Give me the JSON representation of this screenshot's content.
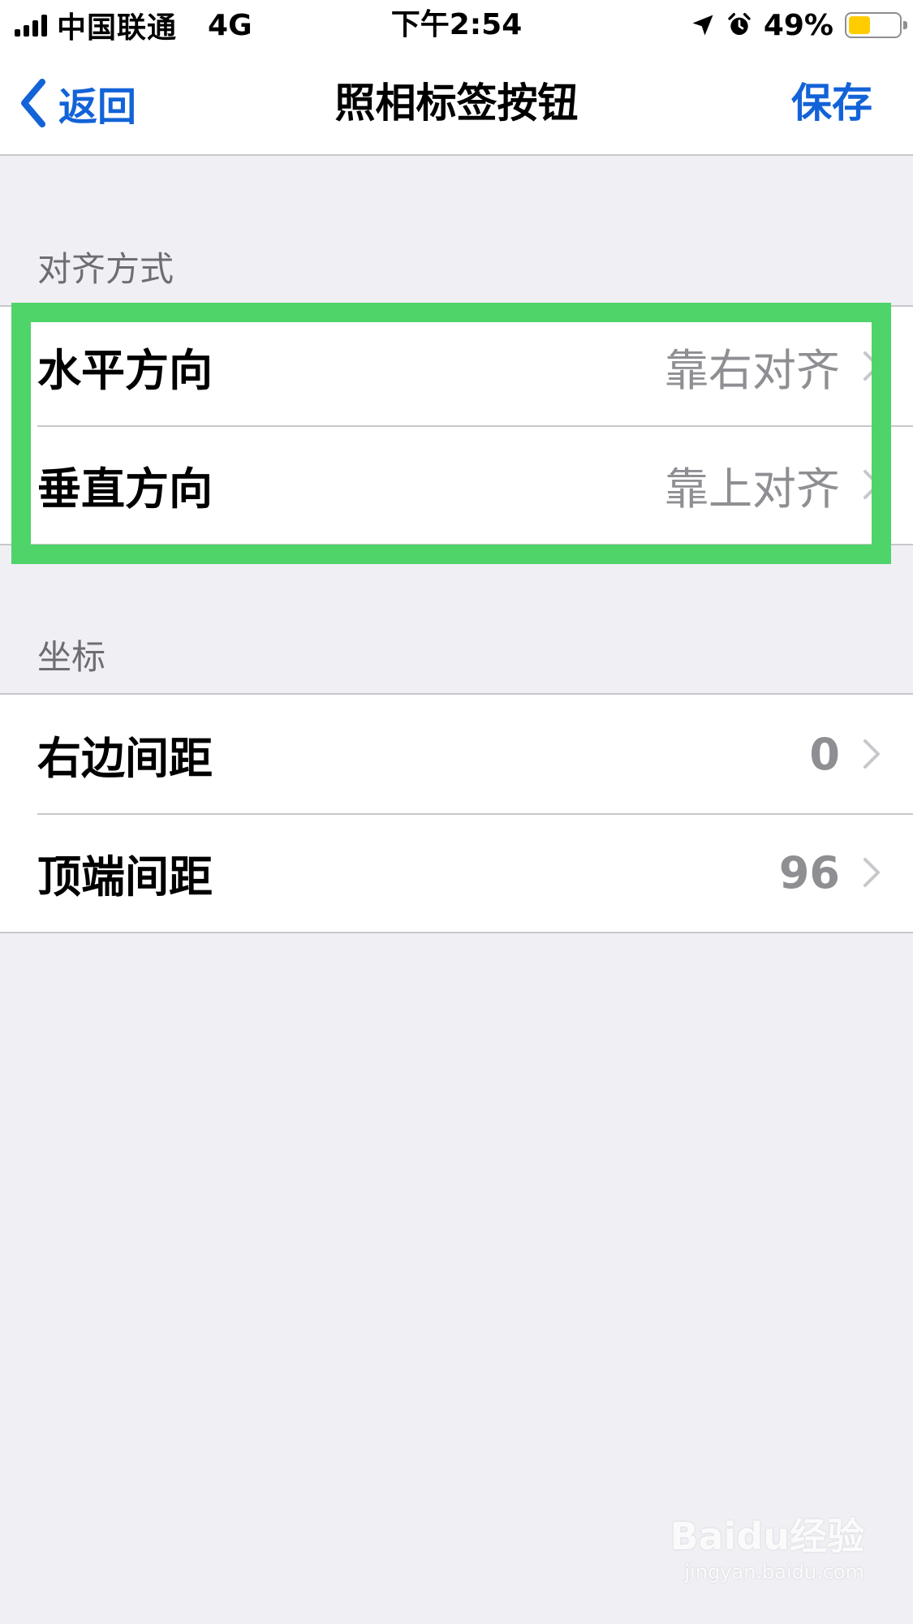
{
  "status_bar": {
    "carrier": "中国联通",
    "network": "4G",
    "time": "下午2:54",
    "battery": "49%",
    "battery_level": 0.49
  },
  "nav": {
    "back_label": "返回",
    "title": "照相标签按钮",
    "save_label": "保存"
  },
  "sections": [
    {
      "header": "对齐方式",
      "rows": [
        {
          "label": "水平方向",
          "value": "靠右对齐"
        },
        {
          "label": "垂直方向",
          "value": "靠上对齐"
        }
      ]
    },
    {
      "header": "坐标",
      "rows": [
        {
          "label": "右边间距",
          "value": "0"
        },
        {
          "label": "顶端间距",
          "value": "96"
        }
      ]
    }
  ],
  "watermark": {
    "main": "Baidu经验",
    "sub": "jingyan.baidu.com"
  },
  "colors": {
    "accent": "#1363d8",
    "highlight": "#4fd46a",
    "background": "#efeff4",
    "battery_fill": "#ffcc00"
  },
  "icons": [
    "signal-icon",
    "location-arrow-icon",
    "alarm-icon",
    "battery-icon",
    "back-chevron-icon",
    "chevron-right-icon"
  ]
}
